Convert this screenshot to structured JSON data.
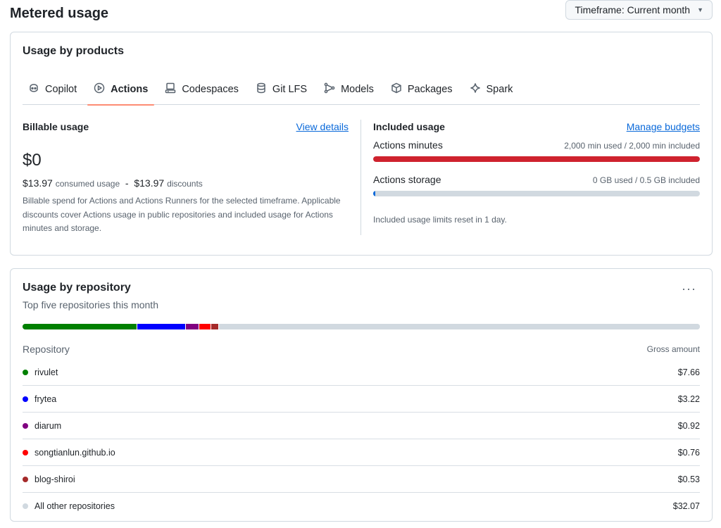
{
  "page": {
    "title": "Metered usage",
    "timeframe_label": "Timeframe: Current month"
  },
  "products": {
    "title": "Usage by products",
    "tabs": [
      {
        "label": "Copilot",
        "icon": "copilot-icon",
        "active": false
      },
      {
        "label": "Actions",
        "icon": "play-circle-icon",
        "active": true
      },
      {
        "label": "Codespaces",
        "icon": "codespaces-icon",
        "active": false
      },
      {
        "label": "Git LFS",
        "icon": "database-icon",
        "active": false
      },
      {
        "label": "Models",
        "icon": "models-icon",
        "active": false
      },
      {
        "label": "Packages",
        "icon": "package-icon",
        "active": false
      },
      {
        "label": "Spark",
        "icon": "spark-icon",
        "active": false
      }
    ]
  },
  "billable": {
    "heading": "Billable usage",
    "link": "View details",
    "amount": "$0",
    "consumed_amount": "$13.97",
    "consumed_label": "consumed usage",
    "separator": "-",
    "discount_amount": "$13.97",
    "discount_label": "discounts",
    "note": "Billable spend for Actions and Actions Runners for the selected timeframe. Applicable discounts cover Actions usage in public repositories and included usage for Actions minutes and storage."
  },
  "included": {
    "heading": "Included usage",
    "link": "Manage budgets",
    "metrics": [
      {
        "label": "Actions minutes",
        "value": "2,000 min used / 2,000 min included",
        "fraction": 1.0,
        "color": "#cf222e"
      },
      {
        "label": "Actions storage",
        "value": "0 GB used / 0.5 GB included",
        "fraction": 0.006,
        "color": "#0969da"
      }
    ],
    "reset_note": "Included usage limits reset in 1 day."
  },
  "repositories": {
    "title": "Usage by repository",
    "subtitle": "Top five repositories this month",
    "more_icon": "kebab-horizontal-icon",
    "col_repo": "Repository",
    "col_amount": "Gross amount",
    "rows": [
      {
        "name": "rivulet",
        "amount": "$7.66",
        "value": 7.66,
        "color": "#008000"
      },
      {
        "name": "frytea",
        "amount": "$3.22",
        "value": 3.22,
        "color": "#0000ff"
      },
      {
        "name": "diarum",
        "amount": "$0.92",
        "value": 0.92,
        "color": "#800080"
      },
      {
        "name": "songtianlun.github.io",
        "amount": "$0.76",
        "value": 0.76,
        "color": "#ff0000"
      },
      {
        "name": "blog-shiroi",
        "amount": "$0.53",
        "value": 0.53,
        "color": "#a52a2a"
      },
      {
        "name": "All other repositories",
        "amount": "$32.07",
        "value": 32.07,
        "color": "#d1d9e0"
      }
    ]
  }
}
